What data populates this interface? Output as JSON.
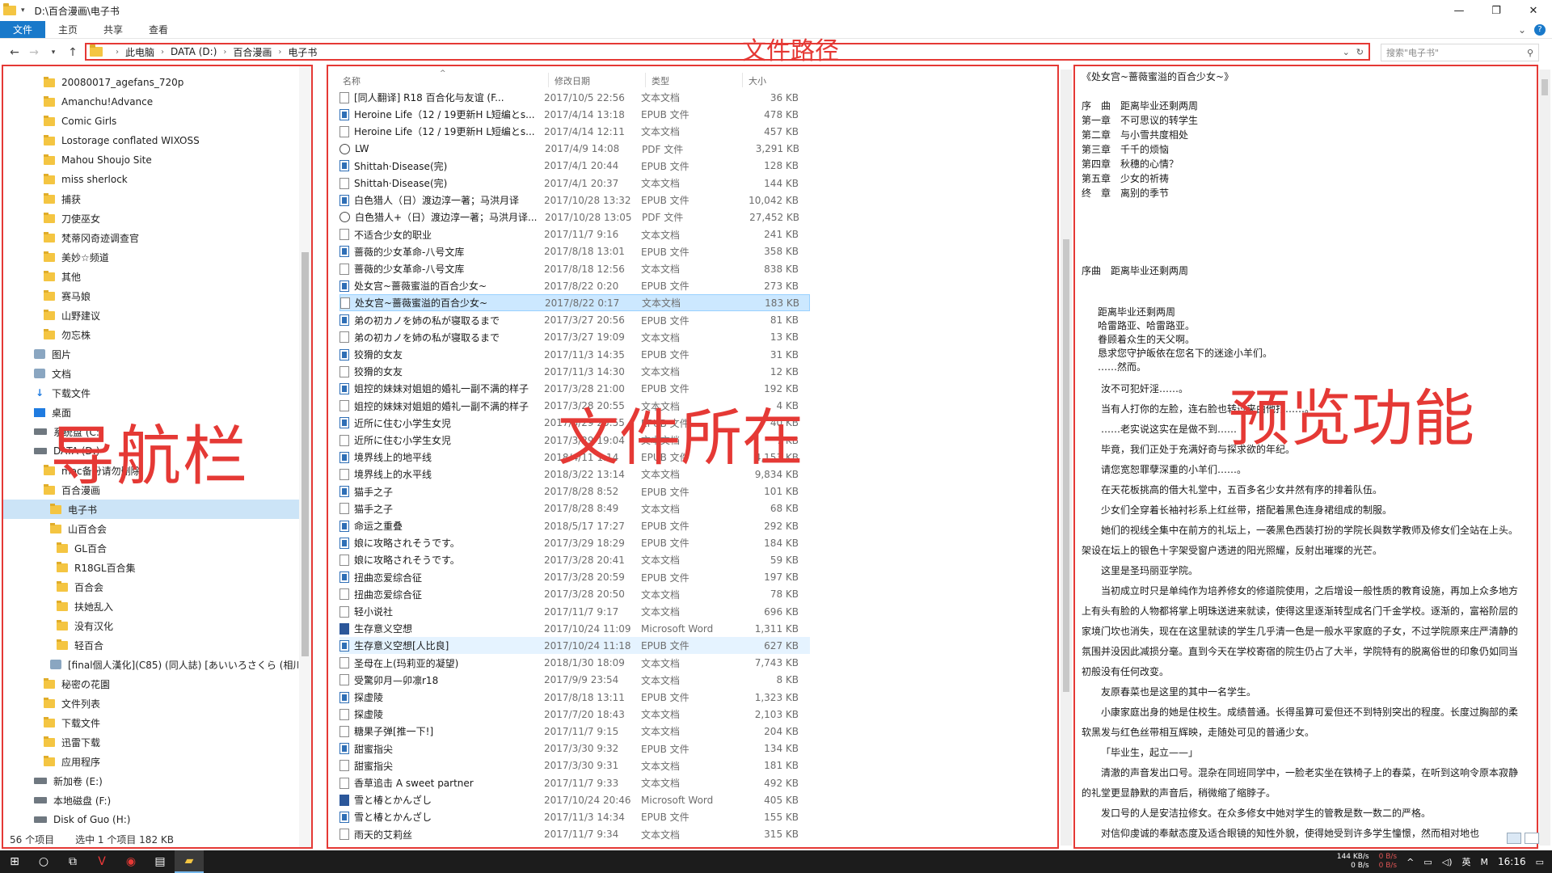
{
  "window": {
    "title": "D:\\百合漫画\\电子书",
    "controls": [
      "—",
      "❐",
      "✕"
    ]
  },
  "ribbon": {
    "tabs": [
      "文件",
      "主页",
      "共享",
      "查看"
    ]
  },
  "address": {
    "crumbs": [
      "此电脑",
      "DATA (D:)",
      "百合漫画",
      "电子书"
    ],
    "search_placeholder": "搜索\"电子书\""
  },
  "labels": {
    "path": "文件路径",
    "nav": "导航栏",
    "files": "文件所在",
    "preview": "预览功能"
  },
  "nav": {
    "items": [
      {
        "label": "20080017_agefans_720p",
        "icon": "folder"
      },
      {
        "label": "Amanchu!Advance",
        "icon": "folder"
      },
      {
        "label": "Comic Girls",
        "icon": "folder"
      },
      {
        "label": "Lostorage conflated WIXOSS",
        "icon": "folder"
      },
      {
        "label": "Mahou Shoujo Site",
        "icon": "folder"
      },
      {
        "label": "miss sherlock",
        "icon": "folder"
      },
      {
        "label": "捕获",
        "icon": "folder"
      },
      {
        "label": "刀使巫女",
        "icon": "folder"
      },
      {
        "label": "梵蒂冈奇迹调查官",
        "icon": "folder"
      },
      {
        "label": "美妙☆频道",
        "icon": "folder"
      },
      {
        "label": "其他",
        "icon": "folder"
      },
      {
        "label": "赛马娘",
        "icon": "folder"
      },
      {
        "label": "山野建议",
        "icon": "folder"
      },
      {
        "label": "勿忘株",
        "icon": "folder"
      },
      {
        "label": "图片",
        "icon": "pictures"
      },
      {
        "label": "文档",
        "icon": "documents"
      },
      {
        "label": "下载文件",
        "icon": "downloads"
      },
      {
        "label": "桌面",
        "icon": "desktop"
      },
      {
        "label": "系统盘 (C:)",
        "icon": "drive"
      },
      {
        "label": "DATA (D:)",
        "icon": "drive"
      },
      {
        "label": "mac备份请勿删除",
        "icon": "folder"
      },
      {
        "label": "百合漫画",
        "icon": "folder"
      },
      {
        "label": "电子书",
        "icon": "folder"
      },
      {
        "label": "山百合会",
        "icon": "folder"
      },
      {
        "label": "GL百合",
        "icon": "folder"
      },
      {
        "label": "R18GL百合集",
        "icon": "folder"
      },
      {
        "label": "百合会",
        "icon": "folder"
      },
      {
        "label": "扶她乱入",
        "icon": "folder"
      },
      {
        "label": "没有汉化",
        "icon": "folder"
      },
      {
        "label": "轻百合",
        "icon": "folder"
      },
      {
        "label": "[final個人漢化](C85) (同人誌) [あいいろさくら (相川りょう)]",
        "icon": "file"
      },
      {
        "label": "秘密の花園",
        "icon": "folder"
      },
      {
        "label": "文件列表",
        "icon": "folder"
      },
      {
        "label": "下载文件",
        "icon": "folder"
      },
      {
        "label": "迅雷下载",
        "icon": "folder"
      },
      {
        "label": "应用程序",
        "icon": "folder"
      },
      {
        "label": "新加卷 (E:)",
        "icon": "drive"
      },
      {
        "label": "本地磁盘 (F:)",
        "icon": "drive"
      },
      {
        "label": "Disk of Guo (H:)",
        "icon": "drive"
      }
    ]
  },
  "status": {
    "count": "56 个项目",
    "selection": "选中 1 个项目  182 KB"
  },
  "file_list": {
    "columns": [
      "名称",
      "修改日期",
      "类型",
      "大小"
    ],
    "rows": [
      {
        "name": "[同人翻译] R18 百合化与友谊 (F...",
        "date": "2017/10/5 22:56",
        "type": "文本文档",
        "size": "36 KB",
        "icon": "txt"
      },
      {
        "name": "Heroine Life（12 / 19更新H L短编とs...",
        "date": "2017/4/14 13:18",
        "type": "EPUB 文件",
        "size": "478 KB",
        "icon": "epub"
      },
      {
        "name": "Heroine Life（12 / 19更新H L短编とs...",
        "date": "2017/4/14 12:11",
        "type": "文本文档",
        "size": "457 KB",
        "icon": "txt"
      },
      {
        "name": "LW",
        "date": "2017/4/9 14:08",
        "type": "PDF 文件",
        "size": "3,291 KB",
        "icon": "pdf"
      },
      {
        "name": "Shittah·Disease(完)",
        "date": "2017/4/1 20:44",
        "type": "EPUB 文件",
        "size": "128 KB",
        "icon": "epub"
      },
      {
        "name": "Shittah·Disease(完)",
        "date": "2017/4/1 20:37",
        "type": "文本文档",
        "size": "144 KB",
        "icon": "txt"
      },
      {
        "name": "白色猎人（日）渡边淳一著；马洪月译",
        "date": "2017/10/28 13:32",
        "type": "EPUB 文件",
        "size": "10,042 KB",
        "icon": "epub"
      },
      {
        "name": "白色猎人+（日）渡边淳一著；马洪月译...",
        "date": "2017/10/28 13:05",
        "type": "PDF 文件",
        "size": "27,452 KB",
        "icon": "pdf"
      },
      {
        "name": "不适合少女的职业",
        "date": "2017/11/7 9:16",
        "type": "文本文档",
        "size": "241 KB",
        "icon": "txt"
      },
      {
        "name": "蔷薇的少女革命-八号文库",
        "date": "2017/8/18 13:01",
        "type": "EPUB 文件",
        "size": "358 KB",
        "icon": "epub"
      },
      {
        "name": "蔷薇的少女革命-八号文库",
        "date": "2017/8/18 12:56",
        "type": "文本文档",
        "size": "838 KB",
        "icon": "txt"
      },
      {
        "name": "处女宫~蔷薇蜜溢的百合少女~",
        "date": "2017/8/22 0:20",
        "type": "EPUB 文件",
        "size": "273 KB",
        "icon": "epub"
      },
      {
        "name": "处女宫~蔷薇蜜溢的百合少女~",
        "date": "2017/8/22 0:17",
        "type": "文本文档",
        "size": "183 KB",
        "icon": "txt",
        "selected": true
      },
      {
        "name": "弟の初カノを姉の私が寝取るまで",
        "date": "2017/3/27 20:56",
        "type": "EPUB 文件",
        "size": "81 KB",
        "icon": "epub"
      },
      {
        "name": "弟の初カノを姉の私が寝取るまで",
        "date": "2017/3/27 19:09",
        "type": "文本文档",
        "size": "13 KB",
        "icon": "txt"
      },
      {
        "name": "狡猾的女友",
        "date": "2017/11/3 14:35",
        "type": "EPUB 文件",
        "size": "31 KB",
        "icon": "epub"
      },
      {
        "name": "狡猾的女友",
        "date": "2017/11/3 14:30",
        "type": "文本文档",
        "size": "12 KB",
        "icon": "txt"
      },
      {
        "name": "姐控的妹妹对姐姐的婚礼一副不满的样子",
        "date": "2017/3/28 21:00",
        "type": "EPUB 文件",
        "size": "192 KB",
        "icon": "epub"
      },
      {
        "name": "姐控的妹妹对姐姐的婚礼一副不满的样子",
        "date": "2017/3/28 20:55",
        "type": "文本文档",
        "size": "4 KB",
        "icon": "txt"
      },
      {
        "name": "近所に住む小学生女児",
        "date": "2017/3/29 20:55",
        "type": "EPUB 文件",
        "size": "40 KB",
        "icon": "epub"
      },
      {
        "name": "近所に住む小学生女児",
        "date": "2017/3/29 19:04",
        "type": "文本文档",
        "size": "7 KB",
        "icon": "txt"
      },
      {
        "name": "境界线上的地平线",
        "date": "2018/4/11 1:14",
        "type": "EPUB 文件",
        "size": "4,153 KB",
        "icon": "epub"
      },
      {
        "name": "境界线上的水平线",
        "date": "2018/3/22 13:14",
        "type": "文本文档",
        "size": "9,834 KB",
        "icon": "txt"
      },
      {
        "name": "猫手之子",
        "date": "2017/8/28 8:52",
        "type": "EPUB 文件",
        "size": "101 KB",
        "icon": "epub"
      },
      {
        "name": "猫手之子",
        "date": "2017/8/28 8:49",
        "type": "文本文档",
        "size": "68 KB",
        "icon": "txt"
      },
      {
        "name": "命运之重叠",
        "date": "2018/5/17 17:27",
        "type": "EPUB 文件",
        "size": "292 KB",
        "icon": "epub"
      },
      {
        "name": "娘に攻略されそうです。",
        "date": "2017/3/29 18:29",
        "type": "EPUB 文件",
        "size": "184 KB",
        "icon": "epub"
      },
      {
        "name": "娘に攻略されそうです。",
        "date": "2017/3/28 20:41",
        "type": "文本文档",
        "size": "59 KB",
        "icon": "txt"
      },
      {
        "name": "扭曲恋爱综合征",
        "date": "2017/3/28 20:59",
        "type": "EPUB 文件",
        "size": "197 KB",
        "icon": "epub"
      },
      {
        "name": "扭曲恋爱综合征",
        "date": "2017/3/28 20:50",
        "type": "文本文档",
        "size": "78 KB",
        "icon": "txt"
      },
      {
        "name": "轻小说社",
        "date": "2017/11/7 9:17",
        "type": "文本文档",
        "size": "696 KB",
        "icon": "txt"
      },
      {
        "name": "生存意义空想",
        "date": "2017/10/24 11:09",
        "type": "Microsoft Word",
        "size": "1,311 KB",
        "icon": "word"
      },
      {
        "name": "生存意义空想[人比良]",
        "date": "2017/10/24 11:18",
        "type": "EPUB 文件",
        "size": "627 KB",
        "icon": "epub",
        "hover": true
      },
      {
        "name": "圣母在上(玛莉亚的凝望)",
        "date": "2018/1/30 18:09",
        "type": "文本文档",
        "size": "7,743 KB",
        "icon": "txt"
      },
      {
        "name": "受驚卯月—卯凛r18",
        "date": "2017/9/9 23:54",
        "type": "文本文档",
        "size": "8 KB",
        "icon": "txt"
      },
      {
        "name": "探虚陵",
        "date": "2017/8/18 13:11",
        "type": "EPUB 文件",
        "size": "1,323 KB",
        "icon": "epub"
      },
      {
        "name": "探虚陵",
        "date": "2017/7/20 18:43",
        "type": "文本文档",
        "size": "2,103 KB",
        "icon": "txt"
      },
      {
        "name": "糖果子弹[推一下!]",
        "date": "2017/11/7 9:15",
        "type": "文本文档",
        "size": "204 KB",
        "icon": "txt"
      },
      {
        "name": "甜蜜指尖",
        "date": "2017/3/30 9:32",
        "type": "EPUB 文件",
        "size": "134 KB",
        "icon": "epub"
      },
      {
        "name": "甜蜜指尖",
        "date": "2017/3/30 9:31",
        "type": "文本文档",
        "size": "181 KB",
        "icon": "txt"
      },
      {
        "name": "香草追击 A sweet partner",
        "date": "2017/11/7 9:33",
        "type": "文本文档",
        "size": "492 KB",
        "icon": "txt"
      },
      {
        "name": "雪と椿とかんざし",
        "date": "2017/10/24 20:46",
        "type": "Microsoft Word",
        "size": "405 KB",
        "icon": "word"
      },
      {
        "name": "雪と椿とかんざし",
        "date": "2017/11/3 14:34",
        "type": "EPUB 文件",
        "size": "155 KB",
        "icon": "epub"
      },
      {
        "name": "雨天的艾莉丝",
        "date": "2017/11/7 9:34",
        "type": "文本文档",
        "size": "315 KB",
        "icon": "txt"
      }
    ]
  },
  "preview": {
    "heading": "《处女宫~蔷薇蜜溢的百合少女~》",
    "toc": [
      "序　曲　距离毕业还剩两周",
      "第一章　不可思议的转学生",
      "第二章　与小雪共度相处",
      "第三章　千千的烦恼",
      "第四章　秋穗的心情？",
      "第五章　少女的祈祷",
      "终　章　离别的季节"
    ],
    "chapter": "序曲　距离毕业还剩两周",
    "poem": [
      "距离毕业还剩两周",
      "哈雷路亚、哈雷路亚。",
      "眷顾着众生的天父啊。",
      "恳求您守护皈依在您名下的迷途小羊们。",
      "……然而。"
    ],
    "paragraphs": [
      "汝不可犯奸淫……。",
      "当有人打你的左脸，连右脸也转过来由他打……。",
      "……老实说这实在是做不到……",
      "毕竟，我们正处于充满好奇与探求欲的年纪。",
      "请您宽恕罪孽深重的小羊们……。",
      "在天花板挑高的借大礼堂中，五百多名少女井然有序的排着队伍。",
      "少女们全穿着长袖衬衫系上红丝带，搭配着黑色连身裙组成的制服。",
      "她们的视线全集中在前方的礼坛上，一袭黑色西装打扮的学院长與数学教师及修女们全站在上头。架设在坛上的银色十字架受窗户透进的阳光照耀，反射出璀璨的光芒。",
      "这里是圣玛丽亚学院。",
      "当初成立时只是单纯作为培养修女的修道院使用，之后增设一般性质的教育设施，再加上众多地方上有头有脸的人物都将掌上明珠送进来就读，使得这里逐渐转型成名门千金学校。逐渐的，富裕阶层的家境门坎也消失，现在在这里就读的学生几乎清一色是一般水平家庭的子女，不过学院原来庄严清静的氛围并没因此减损分毫。直到今天在学校寄宿的院生仍占了大半，学院特有的脱离俗世的印象仍如同当初般没有任何改变。",
      "友原春菜也是这里的其中一名学生。",
      "小康家庭出身的她是住校生。成绩普通。长得虽算可爱但还不到特别突出的程度。长度过胸部的柔软黑发与红色丝带相互辉映，走随处可见的普通少女。",
      "「毕业生，起立——」",
      "清澈的声音发出口号。混杂在同班同学中，一脸老实坐在铁椅子上的春菜，在听到这响令原本寂静的礼堂更显静默的声音后，稍微缩了缩脖子。",
      "发口号的人是安洁拉修女。在众多修女中她对学生的管教是数一数二的严格。",
      "对信仰虔诚的奉献态度及适合眼镜的知性外貌，使得她受到许多学生憧憬，然而相对地也"
    ]
  },
  "taskbar": {
    "net_up": "144 KB/s",
    "net_down": "0 B/s",
    "net2_up": "0 B/s",
    "net2_down": "0 B/s",
    "ime": "英",
    "clock": "16:16"
  }
}
